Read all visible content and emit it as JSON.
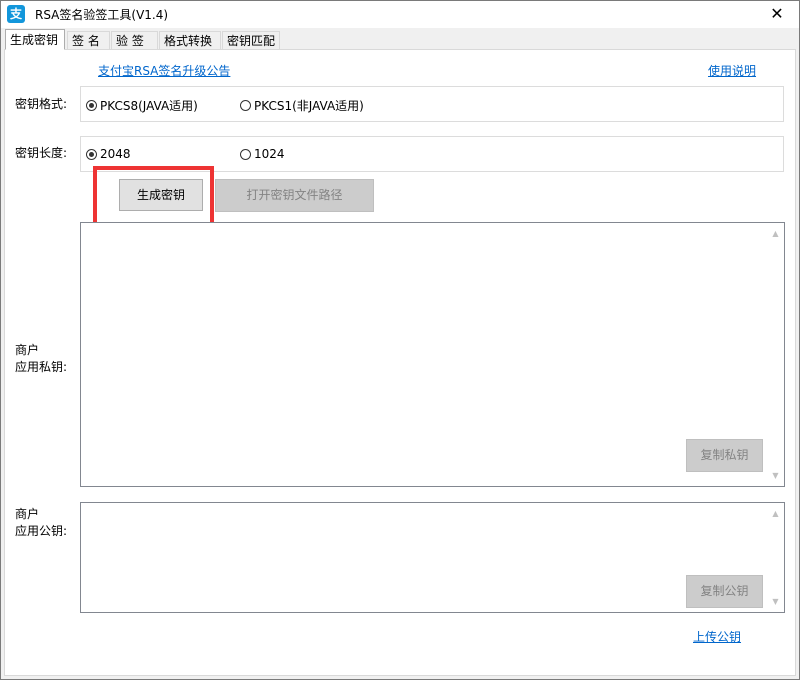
{
  "window": {
    "app_icon": "支",
    "title": "RSA签名验签工具(V1.4)",
    "close": "✕"
  },
  "tabs": [
    "生成密钥",
    "签  名",
    "验  签",
    "格式转换",
    "密钥匹配"
  ],
  "links": {
    "announcement": "支付宝RSA签名升级公告",
    "help": "使用说明",
    "upload_public_key": "上传公钥"
  },
  "key_format": {
    "label": "密钥格式:",
    "options": [
      "PKCS8(JAVA适用)",
      "PKCS1(非JAVA适用)"
    ],
    "selected": "PKCS8(JAVA适用)"
  },
  "key_length": {
    "label": "密钥长度:",
    "options": [
      "2048",
      "1024"
    ],
    "selected": "2048"
  },
  "buttons": {
    "generate": "生成密钥",
    "open_path": "打开密钥文件路径",
    "copy_private": "复制私钥",
    "copy_public": "复制公钥"
  },
  "private_key": {
    "label_line1": "商户",
    "label_line2": "应用私钥:",
    "value": ""
  },
  "public_key": {
    "label_line1": "商户",
    "label_line2": "应用公钥:",
    "value": ""
  },
  "colors": {
    "highlight": "#ee3333",
    "link": "#0066cc"
  }
}
